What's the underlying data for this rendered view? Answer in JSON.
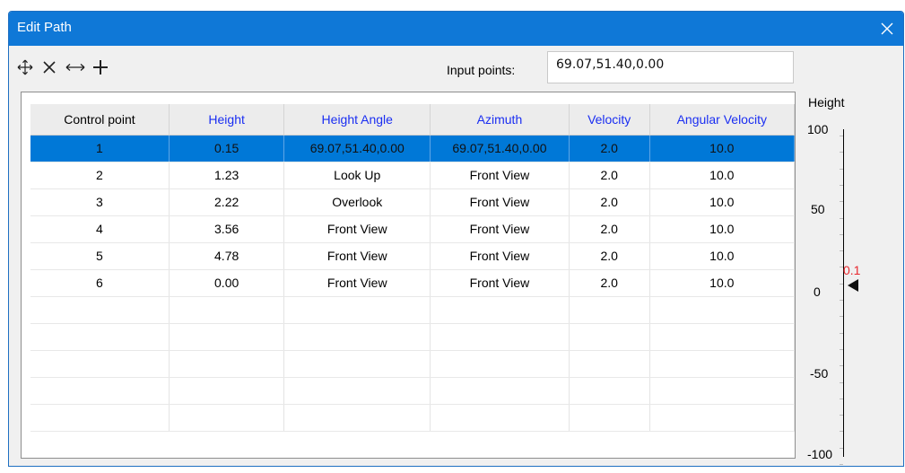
{
  "window": {
    "title": "Edit Path"
  },
  "toolbar": {
    "icons": [
      "move-icon",
      "delete-icon",
      "horizontal-resize-icon",
      "add-icon"
    ],
    "input_label": "Input points:",
    "input_value": "69.07,51.40,0.00"
  },
  "table": {
    "headers": [
      "Control point",
      "Height",
      "Height Angle",
      "Azimuth",
      "Velocity",
      "Angular Velocity"
    ],
    "rows": [
      [
        "1",
        "0.15",
        "69.07,51.40,0.00",
        "69.07,51.40,0.00",
        "2.0",
        "10.0"
      ],
      [
        "2",
        "1.23",
        "Look Up",
        "Front View",
        "2.0",
        "10.0"
      ],
      [
        "3",
        "2.22",
        "Overlook",
        "Front View",
        "2.0",
        "10.0"
      ],
      [
        "4",
        "3.56",
        "Front View",
        "Front View",
        "2.0",
        "10.0"
      ],
      [
        "5",
        "4.78",
        "Front View",
        "Front View",
        "2.0",
        "10.0"
      ],
      [
        "6",
        "0.00",
        "Front View",
        "Front View",
        "2.0",
        "10.0"
      ]
    ],
    "selected_row": 0,
    "empty_rows": 5
  },
  "height_scale": {
    "title": "Height",
    "labels": [
      "100",
      "50",
      "0",
      "-50",
      "-100"
    ],
    "max": 100,
    "min": -100,
    "current_value": "0.1",
    "marker_color": "#e8282e"
  },
  "colors": {
    "title_bar": "#0f78d7",
    "selection": "#0078d7",
    "header_text": "#1a2ef2"
  }
}
